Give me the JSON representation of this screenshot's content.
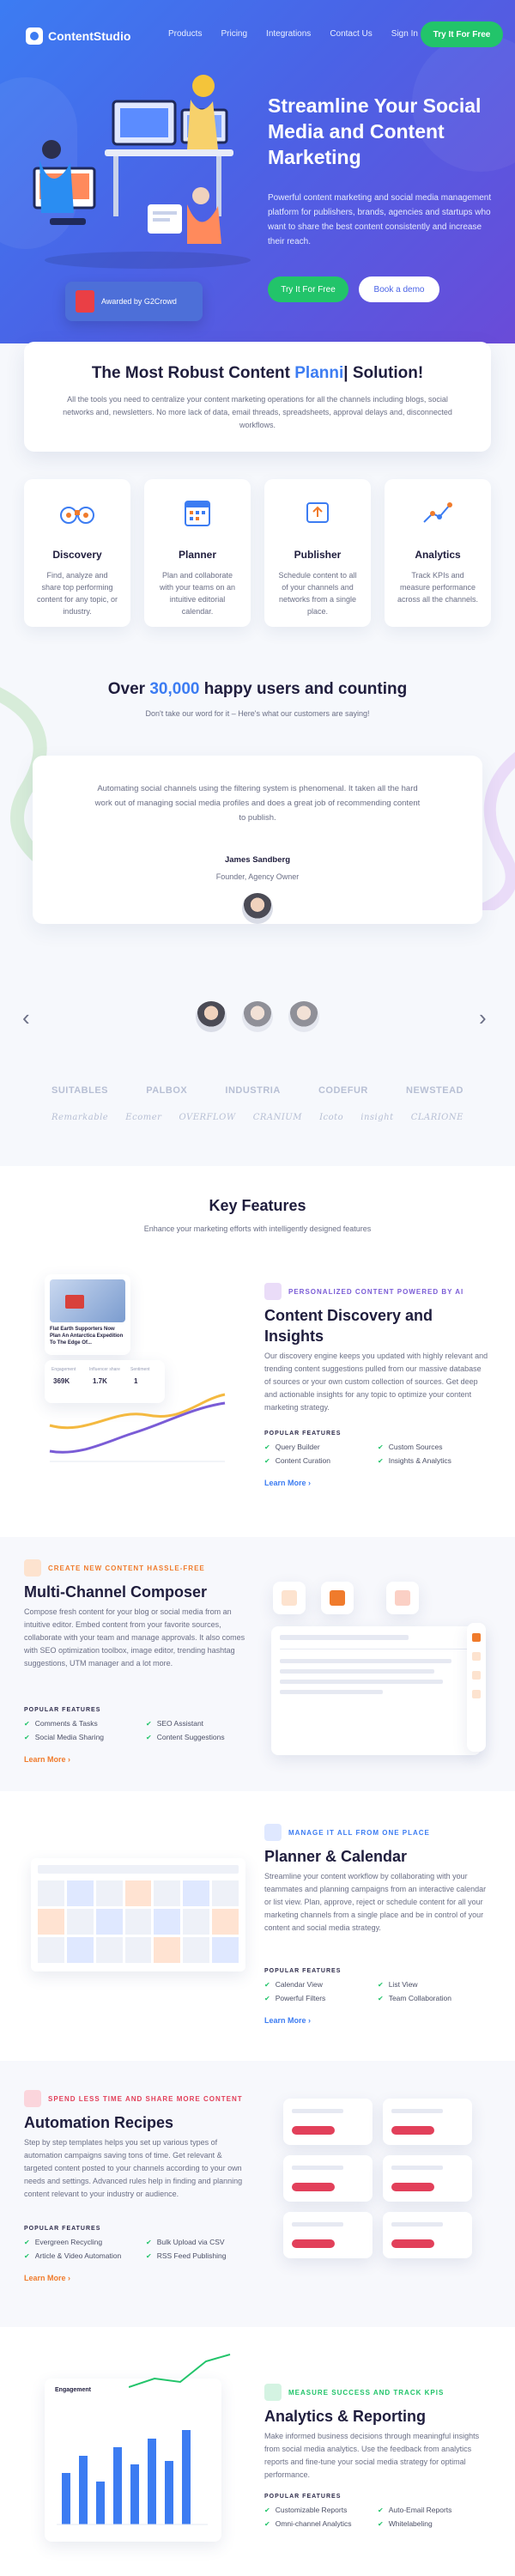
{
  "header": {
    "logo_text": "ContentStudio",
    "nav": [
      "Products",
      "Pricing",
      "Integrations",
      "Contact Us",
      "Sign In"
    ],
    "cta": "Try It For Free"
  },
  "hero": {
    "title": "Streamline Your Social Media and Content Marketing",
    "subtitle": "Powerful content marketing and social media management platform for publishers, brands, agencies and startups who want to share the best content consistently and increase their reach.",
    "btn_primary": "Try It For Free",
    "btn_secondary": "Book a demo",
    "award": "Awarded by G2Crowd"
  },
  "solution": {
    "title_before": "The Most Robust Content ",
    "title_highlight": "Planni",
    "title_after": "| Solution!",
    "text": "All the tools you need to centralize your content marketing operations for all the channels including blogs, social networks and, newsletters. No more lack of data, email threads, spreadsheets, approval delays and, disconnected workflows."
  },
  "cards": [
    {
      "title": "Discovery",
      "text": "Find, analyze and share top performing content for any topic, or industry.",
      "icon": "binoculars-icon"
    },
    {
      "title": "Planner",
      "text": "Plan and collaborate with your teams on an intuitive editorial calendar.",
      "icon": "calendar-icon"
    },
    {
      "title": "Publisher",
      "text": "Schedule content to all of your channels and networks from a single place.",
      "icon": "publish-icon"
    },
    {
      "title": "Analytics",
      "text": "Track KPIs and measure performance across all the channels.",
      "icon": "analytics-icon"
    }
  ],
  "users": {
    "before": "Over ",
    "count": "30,000",
    "after": " happy users and counting",
    "subtitle": "Don't take our word for it – Here's what our customers are saying!"
  },
  "testimonial": {
    "quote": "Automating social channels using the filtering system is phenomenal. It taken all the hard work out of managing social media profiles and does a great job of recommending content to publish.",
    "name": "James Sandberg",
    "role": "Founder, Agency Owner"
  },
  "carousel": {
    "prev": "‹",
    "next": "›"
  },
  "logos_row1": [
    "SUITABLES",
    "PALBOX",
    "INDUSTRIA",
    "CODEFUR",
    "NEWSTEAD"
  ],
  "logos_row2": [
    "Remarkable",
    "Ecomer",
    "OVERFLOW",
    "CRANIUM",
    "Icoto",
    "insight",
    "CLARIONE"
  ],
  "key_features": {
    "title": "Key Features",
    "subtitle": "Enhance your marketing efforts with intelligently designed features"
  },
  "features": [
    {
      "tag": "PERSONALIZED CONTENT POWERED BY AI",
      "title": "Content Discovery and Insights",
      "text": "Our discovery engine keeps you updated with highly relevant and trending content suggestions pulled from our massive database of sources or your own custom collection of sources. Get deep and actionable insights for any topic to optimize your content marketing strategy.",
      "popular_label": "POPULAR FEATURES",
      "items": [
        "Query Builder",
        "Custom Sources",
        "Content Curation",
        "Insights & Analytics"
      ],
      "learn": "Learn More ›",
      "mock": {
        "article": "Flat Earth Supporters Now Plan An Antarctica Expedition To The Edge Of...",
        "stat1": "369K",
        "stat2": "1.7K",
        "stat3": "1",
        "stat1_label": "Engagement",
        "stat2_label": "Influencer share",
        "stat3_label": "Sentiment"
      }
    },
    {
      "tag": "CREATE NEW CONTENT HASSLE-FREE",
      "title": "Multi-Channel Composer",
      "text": "Compose fresh content for your blog or social media from an intuitive editor. Embed content from your favorite sources, collaborate with your team and manage approvals. It also comes with SEO optimization toolbox, image editor, trending hashtag suggestions, UTM manager and a lot more.",
      "popular_label": "POPULAR FEATURES",
      "items": [
        "Comments & Tasks",
        "SEO Assistant",
        "Social Media Sharing",
        "Content Suggestions"
      ],
      "learn": "Learn More ›"
    },
    {
      "tag": "MANAGE IT ALL FROM ONE PLACE",
      "title": "Planner & Calendar",
      "text": "Streamline your content workflow by collaborating with your teammates and planning campaigns from an interactive calendar or list view. Plan, approve, reject or schedule content for all your marketing channels from a single place and be in control of your content and social media strategy.",
      "popular_label": "POPULAR FEATURES",
      "items": [
        "Calendar View",
        "List View",
        "Powerful Filters",
        "Team Collaboration"
      ],
      "learn": "Learn More ›"
    },
    {
      "tag": "SPEND LESS TIME AND SHARE MORE CONTENT",
      "title": "Automation Recipes",
      "text": "Step by step templates helps you set up various types of automation campaigns saving tons of time. Get relevant & targeted content posted to your channels according to your own needs and settings. Advanced rules help in finding and planning content relevant to your industry or audience.",
      "popular_label": "POPULAR FEATURES",
      "items": [
        "Evergreen Recycling",
        "Bulk Upload via CSV",
        "Article & Video Automation",
        "RSS Feed Publishing"
      ],
      "learn": "Learn More ›"
    },
    {
      "tag": "MEASURE SUCCESS AND TRACK KPIS",
      "title": "Analytics & Reporting",
      "text": "Make informed business decisions through meaningful insights from social media analytics. Use the feedback from analytics reports and fine-tune your social media strategy for optimal performance.",
      "popular_label": "POPULAR FEATURES",
      "items": [
        "Customizable Reports",
        "Auto-Email Reports",
        "Omni-channel Analytics",
        "Whitelabeling"
      ],
      "mock": {
        "label": "Engagement"
      }
    }
  ],
  "colors": {
    "primary": "#3c7cf2",
    "green": "#22c46a",
    "orange": "#f07b2c",
    "purple": "#7a5cd6"
  }
}
